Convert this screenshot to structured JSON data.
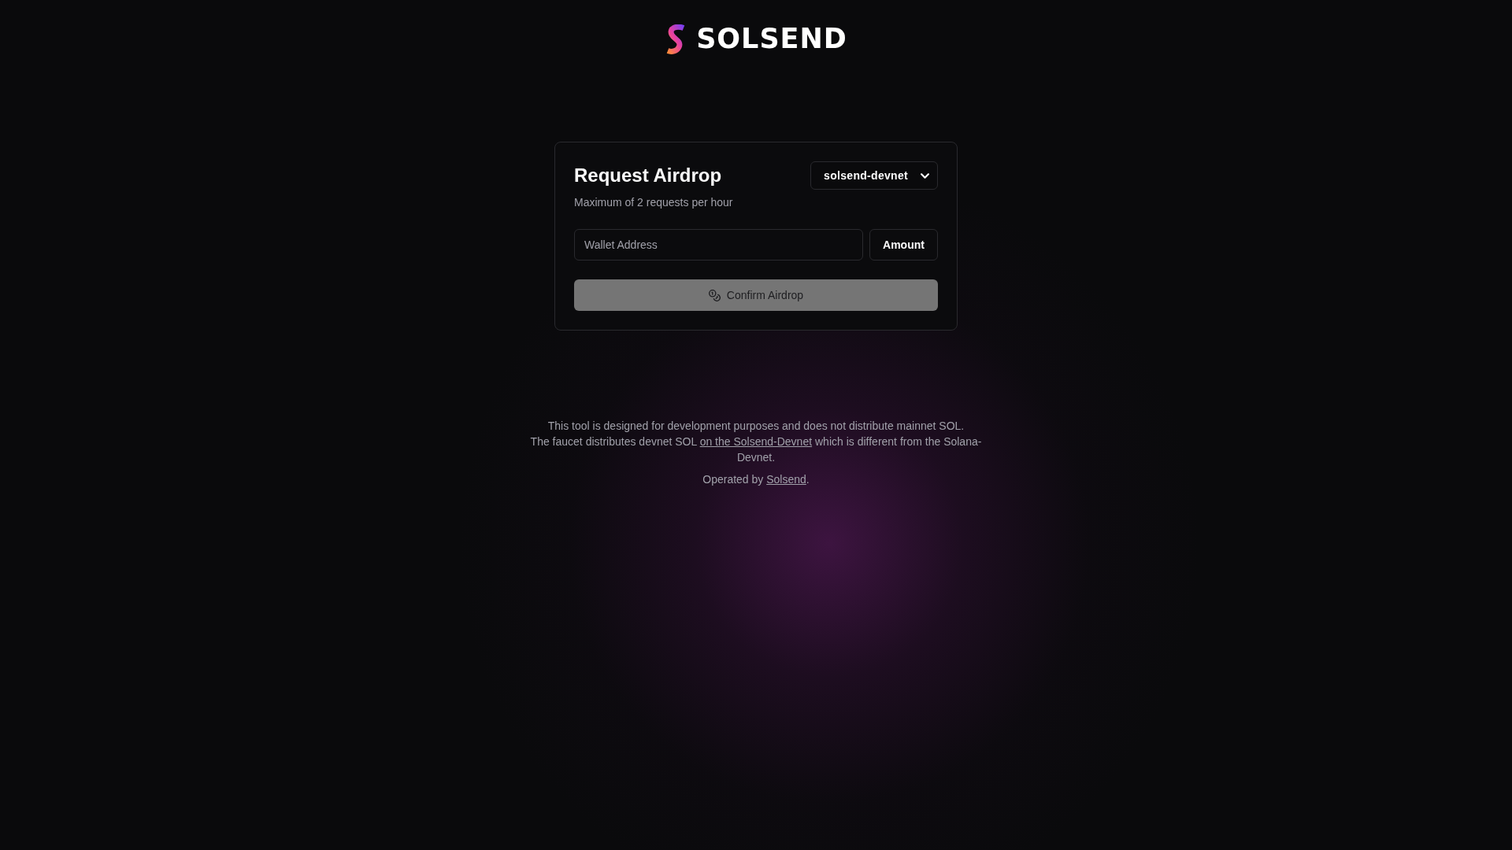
{
  "logo": {
    "text": "SOLSEND"
  },
  "card": {
    "title": "Request Airdrop",
    "subtitle": "Maximum of 2 requests per hour",
    "network_select": {
      "value": "solsend-devnet"
    },
    "wallet_field": {
      "placeholder": "Wallet Address"
    },
    "amount_button": {
      "label": "Amount"
    },
    "confirm_button": {
      "label": "Confirm Airdrop",
      "disabled": true
    }
  },
  "footer": {
    "disclaimer": [
      {
        "segments": [
          {
            "kind": "text",
            "text": "This tool is designed for development purposes and does not distribute mainnet SOL."
          }
        ]
      },
      {
        "segments": [
          {
            "kind": "text",
            "text": "The faucet distributes devnet SOL "
          },
          {
            "kind": "link",
            "text": "on the Solsend-Devnet"
          },
          {
            "kind": "text",
            "text": " which is different from the Solana-Devnet."
          }
        ]
      }
    ],
    "credit": {
      "segments": [
        {
          "kind": "text",
          "text": "Operated by "
        },
        {
          "kind": "link",
          "text": "Solsend"
        },
        {
          "kind": "text",
          "text": "."
        }
      ]
    }
  }
}
